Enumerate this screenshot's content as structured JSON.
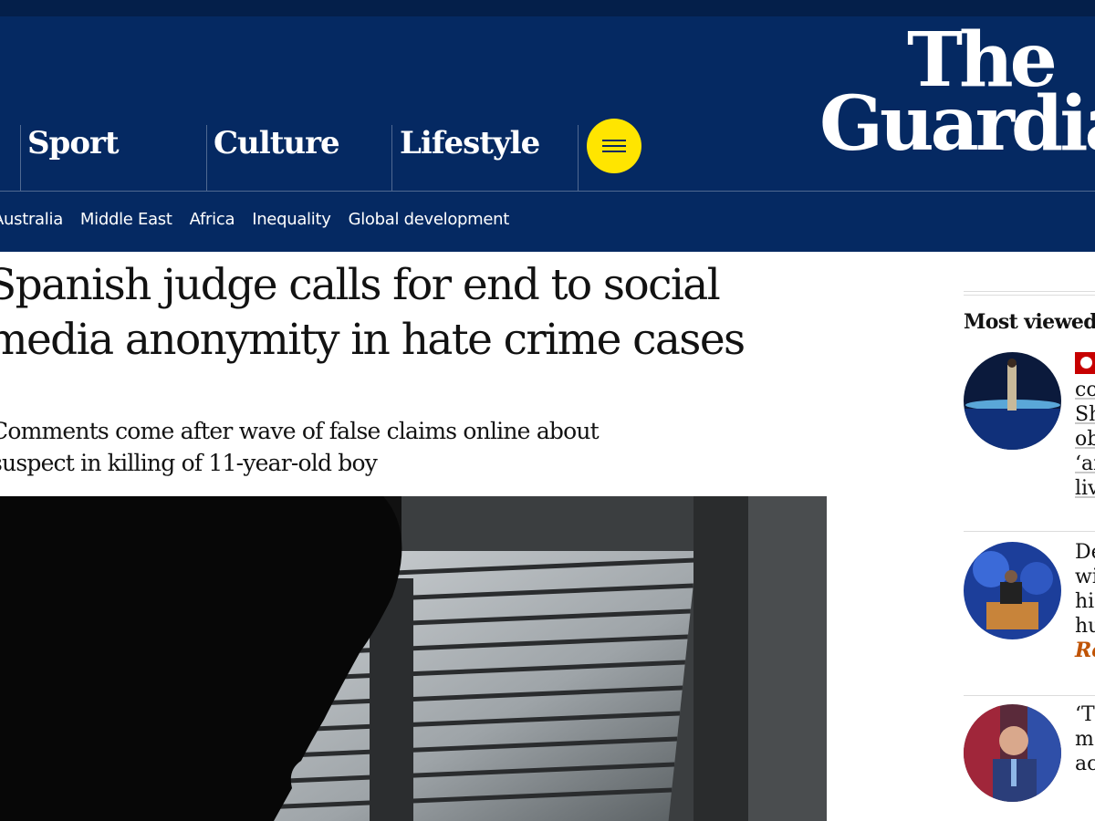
{
  "masthead": {
    "logo_line1": "The",
    "logo_line2": "Guardian",
    "pillars": [
      {
        "label": "Sport"
      },
      {
        "label": "Culture"
      },
      {
        "label": "Lifestyle"
      }
    ],
    "menu_icon": "hamburger-icon",
    "menu_button_color": "#ffe500",
    "brand_color": "#052962"
  },
  "subnav": {
    "items": [
      {
        "label": "Australia"
      },
      {
        "label": "Middle East"
      },
      {
        "label": "Africa"
      },
      {
        "label": "Inequality"
      },
      {
        "label": "Global development"
      }
    ]
  },
  "article": {
    "headline": "Spanish judge calls for end to social media anonymity in hate crime cases",
    "standfirst": "Comments come after wave of false claims online about suspect in killing of 11-year-old boy"
  },
  "most_viewed": {
    "title": "Most viewed",
    "items": [
      {
        "lines": [
          "co",
          "Sh",
          "ob",
          "‘ai",
          "liv"
        ],
        "live": true
      },
      {
        "lines": [
          "De",
          "wi",
          "hi",
          "hu"
        ],
        "kicker": "Re"
      },
      {
        "lines": [
          "‘T",
          "m",
          "ac"
        ]
      }
    ]
  }
}
